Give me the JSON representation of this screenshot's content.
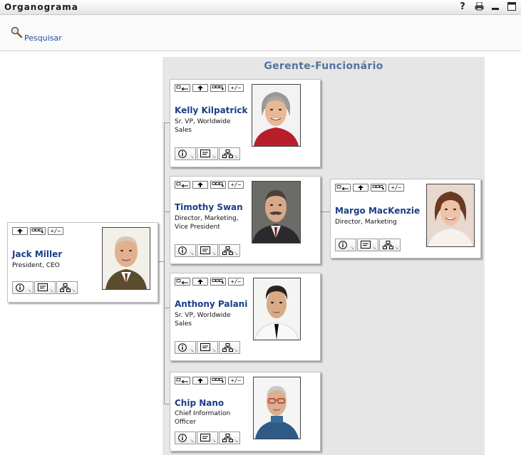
{
  "window": {
    "title": "Organograma",
    "icons": [
      "help-icon",
      "print-icon",
      "minimize-icon",
      "maximize-icon"
    ]
  },
  "toolbar": {
    "search_label": "Pesquisar",
    "search_icon": "magnifier-icon"
  },
  "chart": {
    "title": "Gerente-Funcionário",
    "toggle_label": "+/−"
  },
  "people": {
    "root": {
      "name": "Jack Miller",
      "role": [
        "President, CEO"
      ]
    },
    "reports": [
      {
        "name": "Kelly Kilpatrick",
        "role": [
          "Sr. VP, Worldwide",
          "Sales"
        ]
      },
      {
        "name": "Timothy Swan",
        "role": [
          "Director, Marketing,",
          "Vice President"
        ]
      },
      {
        "name": "Anthony Palani",
        "role": [
          "Sr. VP, Worldwide",
          "Sales"
        ]
      },
      {
        "name": "Chip Nano",
        "role": [
          "Chief Information",
          "Officer"
        ]
      }
    ],
    "sub": {
      "name": "Margo MacKenzie",
      "role": [
        "Director, Marketing"
      ]
    }
  },
  "colors": {
    "name_link": "#1b3e85",
    "chart_title": "#54739c",
    "chart_bg": "#e6e6e6"
  }
}
